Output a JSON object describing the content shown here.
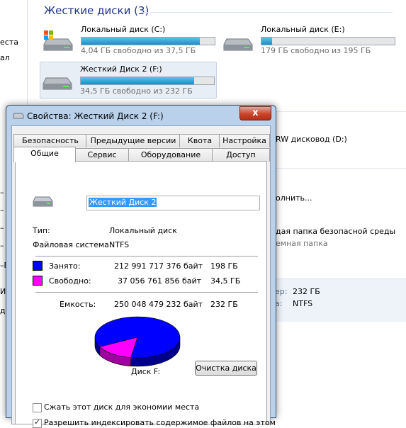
{
  "explorer": {
    "left_pane_fragments": [
      "еста",
      "ал",
      "–",
      "–",
      "–",
      "–",
      "–П",
      "И",
      "д"
    ],
    "group_header": "Жесткие диски (3)",
    "drives": [
      {
        "name": "Локальный диск (C:)",
        "free": "4,04 ГБ свободно из 37,5 ГБ",
        "used_fraction": 0.89
      },
      {
        "name": "Локальный диск (E:)",
        "free": "179 ГБ свободно из 195 ГБ",
        "used_fraction": 0.08
      },
      {
        "name": "Жесткий Диск 2 (F:)",
        "free": "34,5 ГБ свободно из 232 ГБ",
        "used_fraction": 0.85
      }
    ],
    "dvd_label": "RW дисковод (D:)",
    "menu_fragment": "олнить...",
    "secure_folder_title": "дая папка безопасной среды",
    "secure_folder_sub": "емная папка",
    "details": [
      {
        "label": "ер:",
        "value": "232 ГБ"
      },
      {
        "label": "а:",
        "value": "NTFS"
      }
    ]
  },
  "dialog": {
    "title": "Свойства: Жесткий Диск 2 (F:)",
    "close_label": "x",
    "tabs_back": [
      "Безопасность",
      "Предыдущие версии",
      "Квота",
      "Настройка"
    ],
    "tabs_front": [
      "Общие",
      "Сервис",
      "Оборудование",
      "Доступ"
    ],
    "volume_name": "Жесткий Диск 2",
    "type_label": "Тип:",
    "type_value": "Локальный диск",
    "fs_label": "Файловая система:",
    "fs_value": "NTFS",
    "used_label": "Занято:",
    "used_bytes": "212 991 717 376 байт",
    "used_gb": "198 ГБ",
    "free_label": "Свободно:",
    "free_bytes": "37 056 761 856 байт",
    "free_gb": "34,5 ГБ",
    "capacity_label": "Емкость:",
    "capacity_bytes": "250 048 479 232 байт",
    "capacity_gb": "232 ГБ",
    "disk_label": "Диск F:",
    "cleanup_button": "Очистка диска",
    "compress_label": "Сжать этот диск для экономии места",
    "index_label": "Разрешить индексировать содержимое файлов на этом",
    "compress_checked": false,
    "index_checked": true,
    "used_fraction": 0.852,
    "colors": {
      "used": "#0000ff",
      "free": "#ff00ff"
    }
  }
}
